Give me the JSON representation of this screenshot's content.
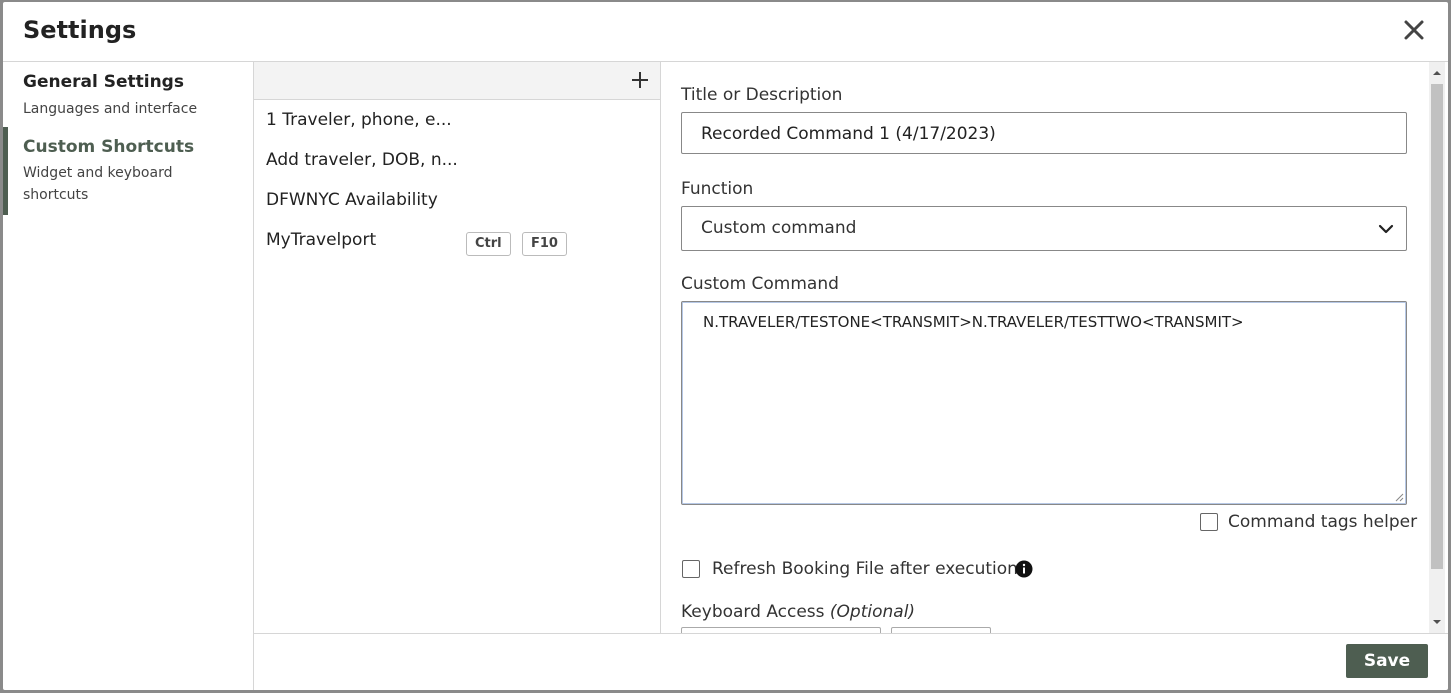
{
  "dialog": {
    "title": "Settings"
  },
  "nav": {
    "items": [
      {
        "title": "General Settings",
        "subtitle": "Languages and interface"
      },
      {
        "title": "Custom Shortcuts",
        "subtitle": "Widget and keyboard shortcuts"
      }
    ]
  },
  "shortcuts": {
    "items": [
      {
        "label": "1 Traveler, phone, e..."
      },
      {
        "label": "Add traveler, DOB, n..."
      },
      {
        "label": "DFWNYC Availability"
      },
      {
        "label": "MyTravelport",
        "keys": [
          "Ctrl",
          "F10"
        ]
      }
    ]
  },
  "form": {
    "title_label": "Title or Description",
    "title_value": "Recorded Command 1 (4/17/2023)",
    "function_label": "Function",
    "function_value": "Custom command",
    "command_label": "Custom Command",
    "command_value": "N.TRAVELER/TESTONE<TRANSMIT>N.TRAVELER/TESTTWO<TRANSMIT>",
    "tags_helper_label": "Command tags helper",
    "refresh_label": "Refresh Booking File after execution",
    "keyboard_label": "Keyboard Access",
    "keyboard_optional": "(Optional)"
  },
  "footer": {
    "save_label": "Save"
  },
  "colors": {
    "accent": "#4e5e51"
  },
  "icons": [
    "close-icon",
    "plus-icon",
    "chevron-down-icon",
    "info-icon"
  ]
}
